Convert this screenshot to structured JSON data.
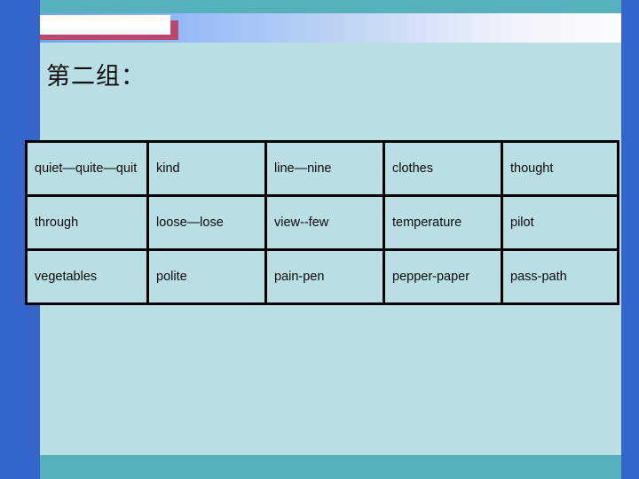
{
  "slide": {
    "title": "第二组：",
    "colors": {
      "page_background": "#b9dfe4",
      "side_rail": "#3365ca",
      "band_teal": "#56b1bc",
      "badge_shadow": "#b8496c",
      "badge_fill": "#ffffff",
      "gradient_start": "#6fa3f7",
      "gradient_end": "#fdfdff",
      "table_border": "#000000",
      "text": "#0a0a0a"
    }
  },
  "table": {
    "rows": [
      {
        "cells": [
          {
            "text": "quiet—quite—quit",
            "indent": 0
          },
          {
            "text": "kind",
            "indent": 0
          },
          {
            "text": "line—nine",
            "indent": 0
          },
          {
            "text": "clothes",
            "indent": 0
          },
          {
            "text": "thought",
            "indent": 0
          }
        ]
      },
      {
        "cells": [
          {
            "text": "through",
            "indent": 0
          },
          {
            "text": "loose—lose",
            "indent": 0
          },
          {
            "text": "view--few",
            "indent": 1
          },
          {
            "text": "temperature",
            "indent": 1
          },
          {
            "text": "pilot",
            "indent": 0
          }
        ]
      },
      {
        "cells": [
          {
            "text": "vegetables",
            "indent": 0
          },
          {
            "text": "polite",
            "indent": 0
          },
          {
            "text": "pain-pen",
            "indent": 0
          },
          {
            "text": "pepper-paper",
            "indent": 0
          },
          {
            "text": "pass-path",
            "indent": 0
          }
        ]
      }
    ]
  }
}
